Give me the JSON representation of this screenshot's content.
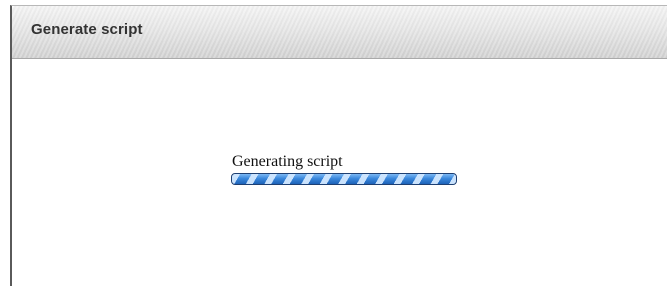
{
  "dialog": {
    "title": "Generate script"
  },
  "progress": {
    "label": "Generating script",
    "fraction": 1.0,
    "style": "indeterminate-striped",
    "colors": {
      "fill": "#2f7fd6",
      "stripe": "#d2e8ff",
      "border": "#1d3f72"
    }
  }
}
